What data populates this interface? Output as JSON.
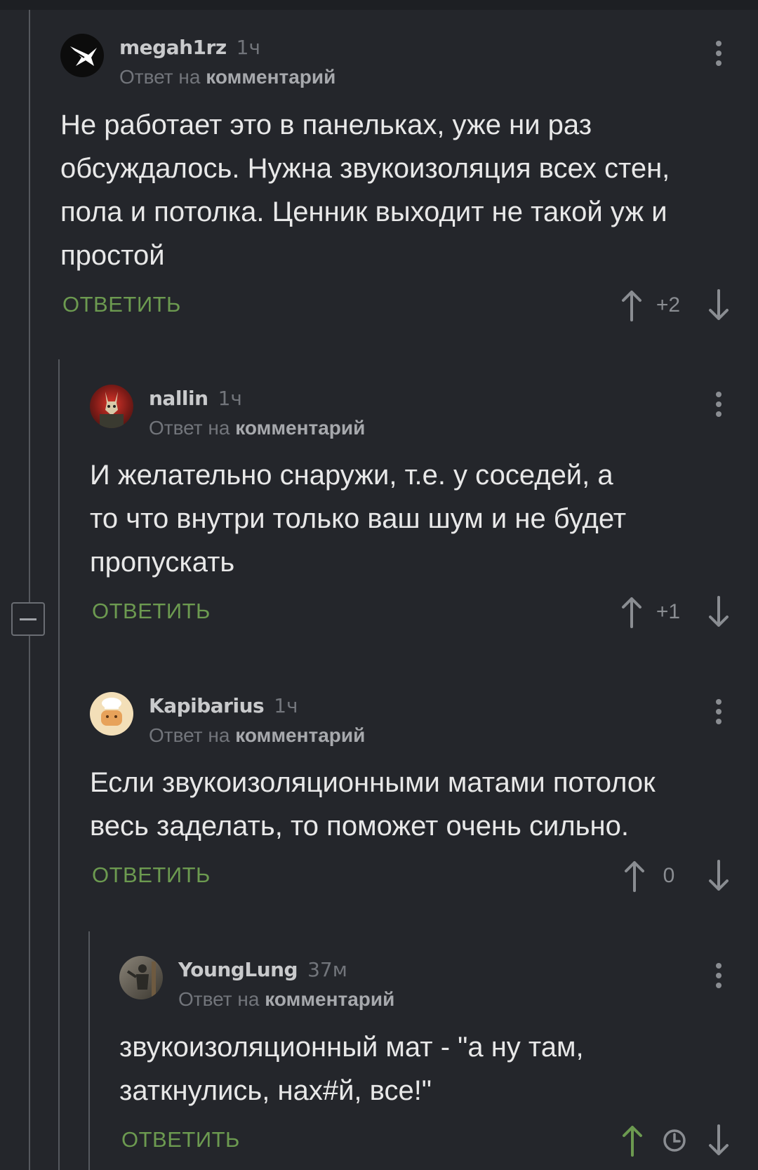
{
  "comments": [
    {
      "username": "megah1rz",
      "time": "1ч",
      "reply_prefix": "Ответ на",
      "reply_target": "комментарий",
      "text": "Не работает это в панельках, уже ни раз\nобсуждалось. Нужна звукоизоляция всех стен,\nпола и потолка. Ценник выходит не такой уж и\nпростой",
      "reply_label": "ОТВЕТИТЬ",
      "rating": "+2",
      "avatar_icon": "white-bird-logo-icon"
    },
    {
      "username": "nallin",
      "time": "1ч",
      "reply_prefix": "Ответ на",
      "reply_target": "комментарий",
      "text": "И желательно снаружи, т.е. у соседей, а\nто что внутри только ваш шум и не будет\nпропускать",
      "reply_label": "ОТВЕТИТЬ",
      "rating": "+1",
      "avatar_icon": "masked-figure-avatar-icon"
    },
    {
      "username": "Kapibarius",
      "time": "1ч",
      "reply_prefix": "Ответ на",
      "reply_target": "комментарий",
      "text": "Если звукоизоляционными матами потолок\nвесь заделать, то поможет очень сильно.",
      "reply_label": "ОТВЕТИТЬ",
      "rating": "0",
      "avatar_icon": "chef-capybara-avatar-icon"
    },
    {
      "username": "YoungLung",
      "time": "37м",
      "reply_prefix": "Ответ на",
      "reply_target": "комментарий",
      "text": "звукоизоляционный мат - \"а ну там,\nзаткнулись, нах#й, все!\"",
      "reply_label": "ОТВЕТИТЬ",
      "rating_icon": "clock-icon",
      "avatar_icon": "person-photo-avatar-icon"
    }
  ],
  "colors": {
    "background": "#24262b",
    "reply_green": "#6c9a50",
    "upvote_active": "#6c9a50",
    "muted": "#72757b"
  }
}
